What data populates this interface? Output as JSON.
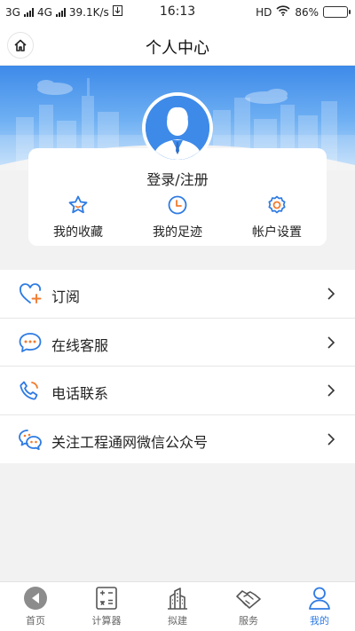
{
  "status_bar": {
    "net1": "3G",
    "net2": "4G",
    "speed": "39.1K/s",
    "time": "16:13",
    "hd": "HD",
    "battery": "86%",
    "battery_level": 0.86
  },
  "nav": {
    "title": "个人中心"
  },
  "profile": {
    "login_label": "登录/注册",
    "actions": [
      {
        "label": "我的收藏",
        "icon": "star-icon"
      },
      {
        "label": "我的足迹",
        "icon": "clock-icon"
      },
      {
        "label": "帐户设置",
        "icon": "gear-icon"
      }
    ]
  },
  "menu": [
    {
      "label": "订阅",
      "icon": "subscribe-heart-icon"
    },
    {
      "label": "在线客服",
      "icon": "chat-bubble-icon"
    },
    {
      "label": "电话联系",
      "icon": "phone-icon"
    },
    {
      "label": "关注工程通网微信公众号",
      "icon": "wechat-icon"
    }
  ],
  "tabs": [
    {
      "label": "首页",
      "icon": "back-arrow-icon"
    },
    {
      "label": "计算器",
      "icon": "calculator-icon"
    },
    {
      "label": "拟建",
      "icon": "building-icon"
    },
    {
      "label": "服务",
      "icon": "handshake-icon"
    },
    {
      "label": "我的",
      "icon": "user-icon",
      "active": true
    }
  ],
  "colors": {
    "accent": "#2e7be3",
    "sky_top": "#3d8ae9",
    "sky_bottom": "#b9dafa",
    "icon_orange": "#f27b2e"
  }
}
